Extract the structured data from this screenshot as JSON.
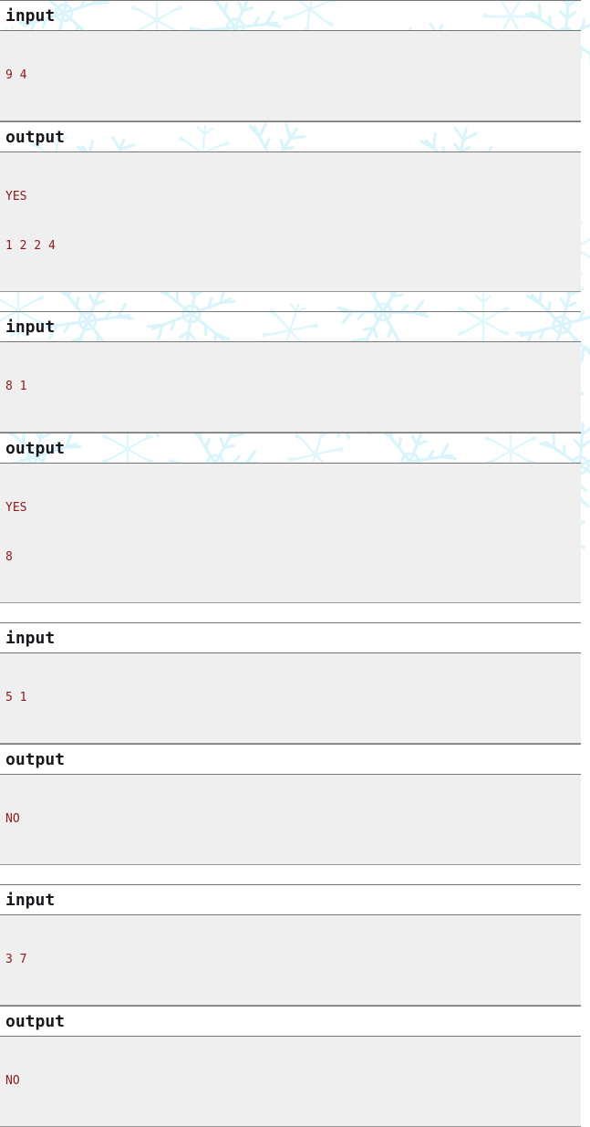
{
  "page": {
    "title": "Sample test cases listing",
    "colors": {
      "body_background": "#ffffff",
      "snowflake": "#d9f5fb",
      "data_row_background": "#efefef",
      "data_text": "#8b1a1a",
      "heading_text": "#17171c",
      "divider": "#777777"
    }
  },
  "labels": {
    "input": "input",
    "output": "output"
  },
  "cases": [
    {
      "input_label": "input",
      "input_lines": [
        "9 4"
      ],
      "output_label": "output",
      "output_lines": [
        "YES",
        "1 2 2 4"
      ]
    },
    {
      "input_label": "input",
      "input_lines": [
        "8 1"
      ],
      "output_label": "output",
      "output_lines": [
        "YES",
        "8"
      ]
    },
    {
      "input_label": "input",
      "input_lines": [
        "5 1"
      ],
      "output_label": "output",
      "output_lines": [
        "NO"
      ]
    },
    {
      "input_label": "input",
      "input_lines": [
        "3 7"
      ],
      "output_label": "output",
      "output_lines": [
        "NO"
      ]
    }
  ]
}
